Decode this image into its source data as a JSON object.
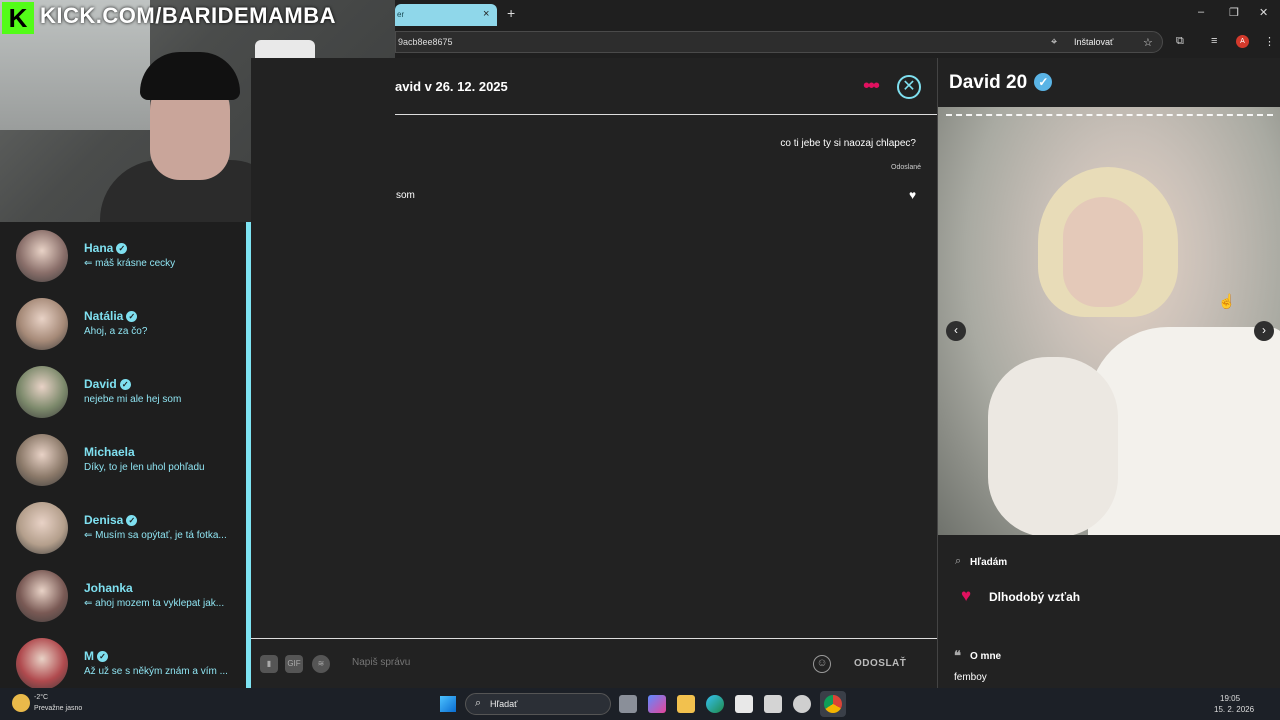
{
  "browser": {
    "tab_title": "er",
    "tab_close": "×",
    "new_tab": "+",
    "url": "9acb8ee8675",
    "install_label": "Inštalovať",
    "profile_initial": "A",
    "window_controls": {
      "minimize": "–",
      "maximize": "❐",
      "close": "✕"
    }
  },
  "stream": {
    "logo_letter": "K",
    "channel_url": "KICK.COM/BARIDEMAMBA"
  },
  "conversations": [
    {
      "name": "Hana",
      "verified": true,
      "message": "⇐ máš krásne cecky",
      "avatar_color": "#8a6f6a"
    },
    {
      "name": "Natália",
      "verified": true,
      "message": "Ahoj, a za čo?",
      "avatar_color": "#a68a78"
    },
    {
      "name": "David",
      "verified": true,
      "message": "nejebe mi ale hej som",
      "avatar_color": "#7d8a6c"
    },
    {
      "name": "Michaela",
      "verified": false,
      "message": "Díky, to je len uhol pohľadu",
      "avatar_color": "#8c7a6a"
    },
    {
      "name": "Denisa",
      "verified": true,
      "message": "⇐ Musím sa opýtať, je tá fotka...",
      "avatar_color": "#b49f8c"
    },
    {
      "name": "Johanka",
      "verified": false,
      "message": "⇐ ahoj mozem ta vyklepat jak...",
      "avatar_color": "#7a5a55"
    },
    {
      "name": "M",
      "verified": true,
      "message": "Až už se s někým znám a vím ...",
      "avatar_color": "#b04a4e"
    }
  ],
  "chat": {
    "header_title": "avid v 26. 12. 2025",
    "more_icon": "•••",
    "close_icon": "⊗",
    "sent_message": "co ti jebe ty si naozaj chlapec?",
    "sent_status": "Odoslané",
    "received_message": "som",
    "heart": "♥",
    "input_placeholder": "Napiš správu",
    "gif_label": "GIF",
    "send_label": "ODOSLAŤ",
    "emoji_icon": "☺"
  },
  "profile": {
    "name": "David 20",
    "verified_icon": "✓",
    "prev_arrow": "‹",
    "next_arrow": "›",
    "cursor": "☝",
    "looking_label": "Hľadám",
    "relationship": "Dlhodobý vzťah",
    "about_label": "O mne",
    "about_text": "femboy"
  },
  "taskbar": {
    "temperature": "-2°C",
    "weather_desc": "Prevažne jasno",
    "search_label": "Hľadať",
    "time": "19:05",
    "date": "15. 2. 2026"
  },
  "colors": {
    "accent_cyan": "#7fe0f0",
    "accent_pink": "#e0115f",
    "kick_green": "#53fc18"
  }
}
